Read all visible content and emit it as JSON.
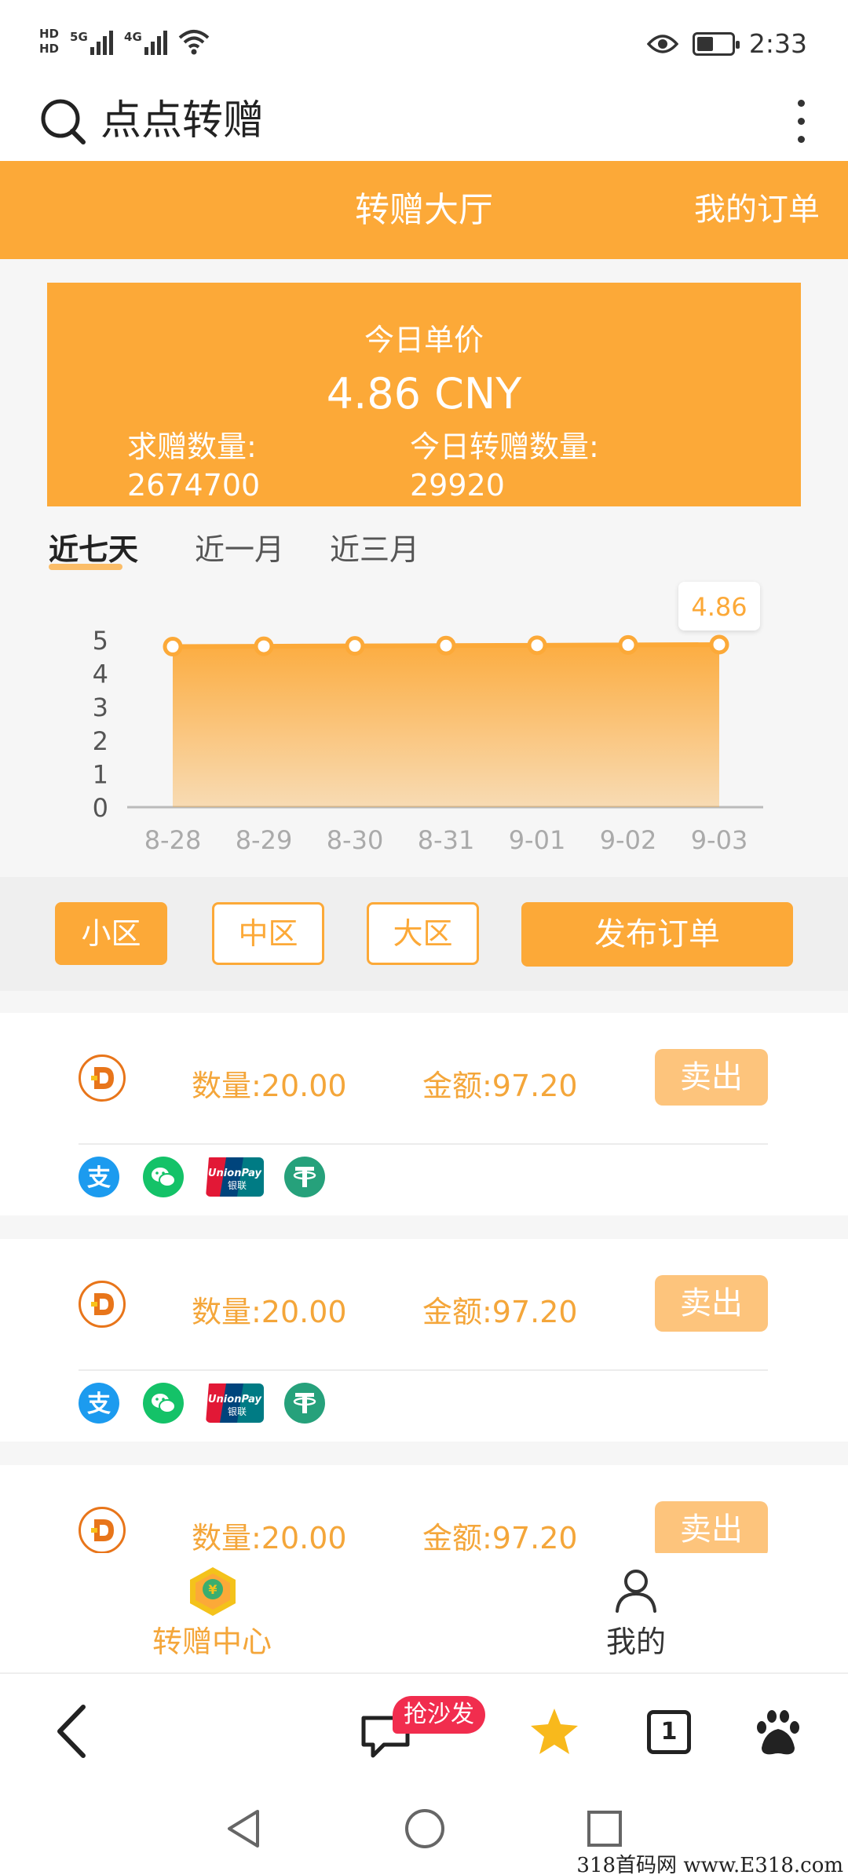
{
  "status_bar": {
    "hd1": "HD",
    "hd2": "HD",
    "sim1_net": "5G",
    "sim2_net": "4G",
    "time": "2:33"
  },
  "browser_title": {
    "text": "点点转赠"
  },
  "header": {
    "title": "转赠大厅",
    "my_orders": "我的订单"
  },
  "price_card": {
    "label": "今日单价",
    "price": "4.86 CNY",
    "request_qty_label": "求赠数量:",
    "request_qty_value": "2674700",
    "today_transfer_label": "今日转赠数量:",
    "today_transfer_value": "29920"
  },
  "range_tabs": [
    {
      "label": "近七天",
      "active": true
    },
    {
      "label": "近一月",
      "active": false
    },
    {
      "label": "近三月",
      "active": false
    }
  ],
  "chart_data": {
    "type": "area",
    "categories": [
      "8-28",
      "8-29",
      "8-30",
      "8-31",
      "9-01",
      "9-02",
      "9-03"
    ],
    "values": [
      4.8,
      4.81,
      4.82,
      4.83,
      4.84,
      4.85,
      4.86
    ],
    "y_ticks": [
      "0",
      "1",
      "2",
      "3",
      "4",
      "5"
    ],
    "ylim": [
      0,
      5
    ],
    "tooltip": "4.86",
    "color": "#fca938"
  },
  "zones": [
    {
      "label": "小区",
      "active": true
    },
    {
      "label": "中区",
      "active": false
    },
    {
      "label": "大区",
      "active": false
    }
  ],
  "publish_button": "发布订单",
  "orders": [
    {
      "qty": "数量:20.00",
      "amount": "金额:97.20",
      "action": "卖出"
    },
    {
      "qty": "数量:20.00",
      "amount": "金额:97.20",
      "action": "卖出"
    },
    {
      "qty": "数量:20.00",
      "amount": "金额:97.20",
      "action": "卖出"
    }
  ],
  "payment_icons": [
    "alipay-icon",
    "wechat-pay-icon",
    "unionpay-icon",
    "usdt-icon"
  ],
  "unionpay_text": "UnionPay",
  "unionpay_cn": "银联",
  "app_tabs": [
    {
      "label": "转赠中心",
      "icon": "transfer-center-icon",
      "color": "#f4a63a",
      "badge_symbol": "¥"
    },
    {
      "label": "我的",
      "icon": "profile-icon",
      "color": "#333333"
    }
  ],
  "browser_toolbar": {
    "badge": "抢沙发",
    "tabs_count": "1"
  },
  "watermark": "318首码网 www.E318.com"
}
